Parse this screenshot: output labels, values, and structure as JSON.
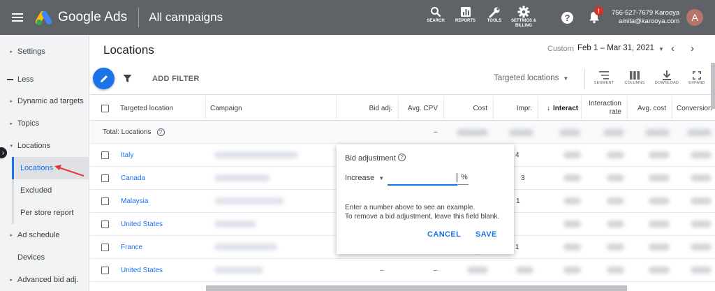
{
  "topbar": {
    "brand": "Google Ads",
    "page_heading": "All campaigns",
    "tools": [
      {
        "label": "SEARCH"
      },
      {
        "label": "REPORTS"
      },
      {
        "label": "TOOLS"
      },
      {
        "label_line1": "SETTINGS &",
        "label_line2": "BILLING"
      }
    ],
    "help": "?",
    "notification_badge": "!",
    "account_phone": "756-527-7679 Karooya",
    "account_email": "amita@karooya.com",
    "avatar_letter": "A"
  },
  "sidebar": {
    "items": [
      {
        "label": "Settings"
      },
      {
        "label": "Less"
      },
      {
        "label": "Dynamic ad targets"
      },
      {
        "label": "Topics"
      },
      {
        "label": "Locations"
      },
      {
        "label": "Locations"
      },
      {
        "label": "Excluded"
      },
      {
        "label": "Per store report"
      },
      {
        "label": "Ad schedule"
      },
      {
        "label": "Devices"
      },
      {
        "label": "Advanced bid adj."
      }
    ]
  },
  "main": {
    "title": "Locations",
    "date_label": "Custom",
    "date_value": "Feb 1 – Mar 31, 2021",
    "add_filter": "ADD FILTER",
    "targeted_dropdown": "Targeted locations",
    "toolbar_buttons": [
      {
        "label": "SEGMENT"
      },
      {
        "label": "COLUMNS"
      },
      {
        "label": "DOWNLOAD"
      },
      {
        "label": "EXPAND"
      }
    ]
  },
  "table": {
    "columns": [
      {
        "label": "Targeted location"
      },
      {
        "label": "Campaign"
      },
      {
        "label": "Bid adj."
      },
      {
        "label": "Avg. CPV"
      },
      {
        "label": "Cost"
      },
      {
        "label": "Impr."
      },
      {
        "label": "Interact"
      },
      {
        "label_line1": "Interaction",
        "label_line2": "rate"
      },
      {
        "label": "Avg. cost"
      },
      {
        "label": "Conversion"
      }
    ],
    "total_label": "Total: Locations",
    "total_cpv": "–",
    "rows": [
      {
        "location": "Italy",
        "impr_partial": "4"
      },
      {
        "location": "Canada",
        "impr_partial": "3"
      },
      {
        "location": "Malaysia",
        "impr_partial": "1"
      },
      {
        "location": "United States",
        "impr_partial": ""
      },
      {
        "location": "France",
        "impr_partial": "1"
      },
      {
        "location": "United States",
        "impr_partial": "",
        "bid": "–",
        "cpv": "–"
      }
    ]
  },
  "popup": {
    "title": "Bid adjustment",
    "help": "?",
    "select_value": "Increase",
    "input_value": "",
    "unit": "%",
    "message_line1": "Enter a number above to see an example.",
    "message_line2": "To remove a bid adjustment, leave this field blank.",
    "cancel": "CANCEL",
    "save": "SAVE"
  },
  "colors": {
    "topbar": "#5f6368",
    "accent": "#1a73e8",
    "annotation_arrow": "#e53935"
  }
}
